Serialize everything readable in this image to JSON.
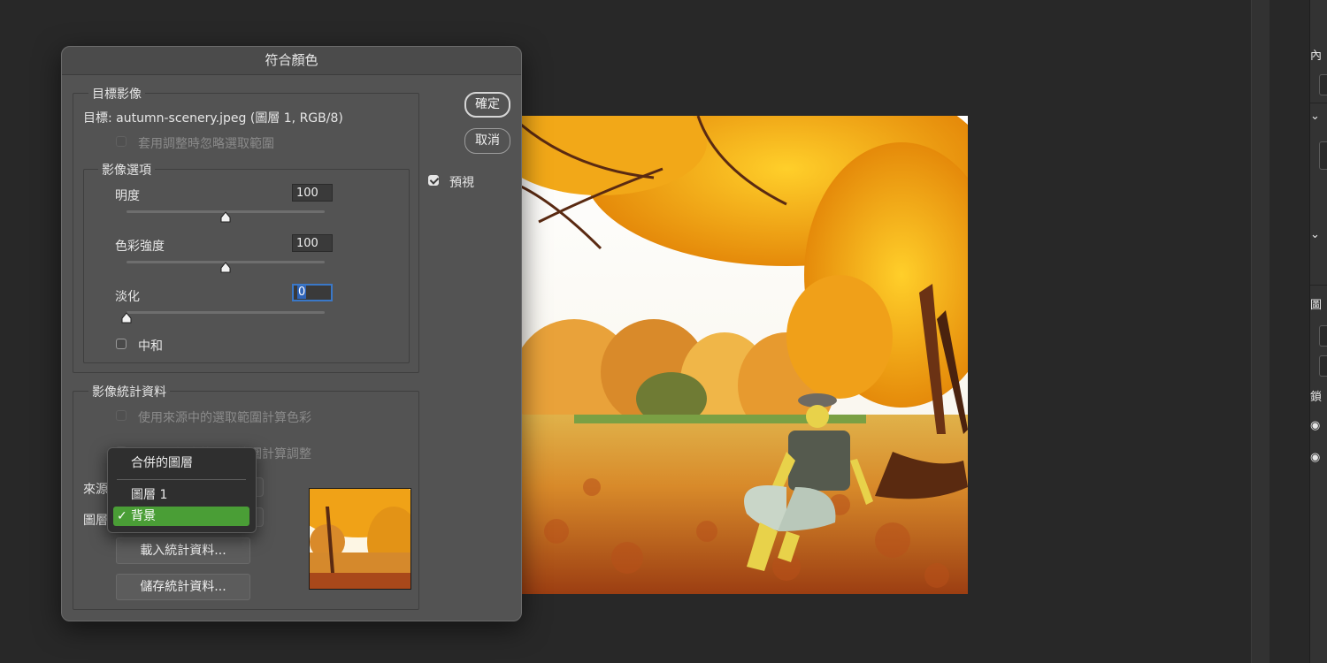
{
  "dialog": {
    "title": "符合顏色",
    "ok_label": "確定",
    "cancel_label": "取消",
    "preview_label": "預視",
    "preview_checked": true,
    "target_group": {
      "legend": "目標影像",
      "target_text": "目標:  autumn-scenery.jpeg (圖層 1, RGB/8)",
      "ignore_selection_label": "套用調整時忽略選取範圍"
    },
    "image_options": {
      "legend": "影像選項",
      "luminance_label": "明度",
      "luminance_value": "100",
      "color_intensity_label": "色彩強度",
      "color_intensity_value": "100",
      "fade_label": "淡化",
      "fade_value": "0",
      "neutralize_label": "中和",
      "slider_levels": {
        "luminance": 0.5,
        "color_intensity": 0.5,
        "fade": 0.0
      }
    },
    "statistics": {
      "legend": "影像統計資料",
      "use_source_selection_label": "使用來源中的選取範圍計算色彩",
      "use_target_selection_label": "使用目標中的選取範圍計算調整",
      "source_label": "來源",
      "layer_label": "圖層",
      "load_button": "載入統計資料...",
      "save_button": "儲存統計資料..."
    }
  },
  "layer_menu": {
    "items": [
      "合併的圖層",
      "圖層 1",
      "背景"
    ],
    "selected": "背景",
    "check_glyph": "✓"
  },
  "colors": {
    "accent_green": "#4a9e36",
    "focus_blue": "#3a78c8",
    "dialog_bg": "#535353",
    "app_bg": "#282828"
  },
  "right_panel": {
    "label_top": "內",
    "label_layers": "圖",
    "label_lock": "鎖"
  }
}
